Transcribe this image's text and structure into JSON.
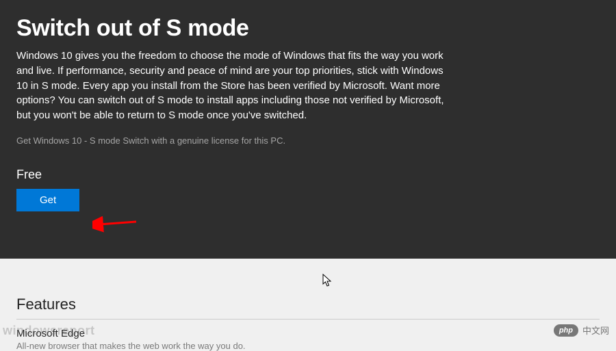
{
  "header": {
    "title": "Switch out of S mode",
    "description": "Windows 10 gives you the freedom to choose the mode of Windows that fits the way you work and live. If performance, security and peace of mind are your top priorities, stick with Windows 10 in S mode.  Every app you install from the Store has been verified by Microsoft. Want more options? You can switch out of S mode to install apps including those not verified by Microsoft, but you won't be able to return to S mode once you've switched.",
    "license_text": "Get Windows 10 - S mode Switch with a genuine license for this PC.",
    "price": "Free",
    "get_label": "Get"
  },
  "features": {
    "heading": "Features",
    "items": [
      {
        "title": "Microsoft Edge",
        "subtitle": "All-new browser that makes the web work the way you do."
      }
    ]
  },
  "watermarks": {
    "left": "windowsreport",
    "right_badge": "php",
    "right_text": "中文网"
  }
}
